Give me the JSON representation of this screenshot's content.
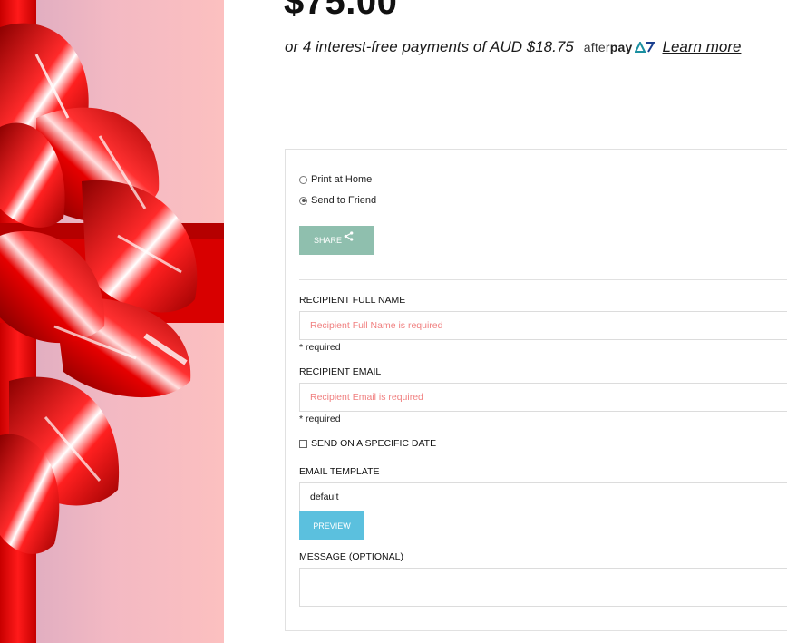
{
  "product": {
    "price": "$75.00",
    "installments_text": "or 4 interest-free payments of AUD $18.75",
    "afterpay_logo_light": "after",
    "afterpay_logo_bold": "pay",
    "learn_more": " Learn more"
  },
  "delivery": {
    "options": [
      {
        "label": "Print at Home",
        "selected": false
      },
      {
        "label": "Send to Friend",
        "selected": true
      }
    ],
    "share_label": "SHARE"
  },
  "form": {
    "recipient_name": {
      "label": "RECIPIENT FULL NAME",
      "placeholder": "Recipient Full Name is required",
      "note": "* required"
    },
    "recipient_email": {
      "label": "RECIPIENT EMAIL",
      "placeholder": "Recipient Email is required",
      "note": "* required"
    },
    "specific_date": {
      "label": "SEND ON A SPECIFIC DATE",
      "checked": false
    },
    "email_template": {
      "label": "EMAIL TEMPLATE",
      "value": "default",
      "preview_label": "PREVIEW"
    },
    "message": {
      "label": "MESSAGE (OPTIONAL)",
      "value": ""
    }
  },
  "colors": {
    "share_button": "#8fbfae",
    "preview_button": "#5bc0de",
    "error_placeholder": "#f08080",
    "ribbon_red": "#e00000"
  },
  "icons": {
    "share": "share-icon",
    "afterpay": "afterpay-arrows-icon"
  }
}
